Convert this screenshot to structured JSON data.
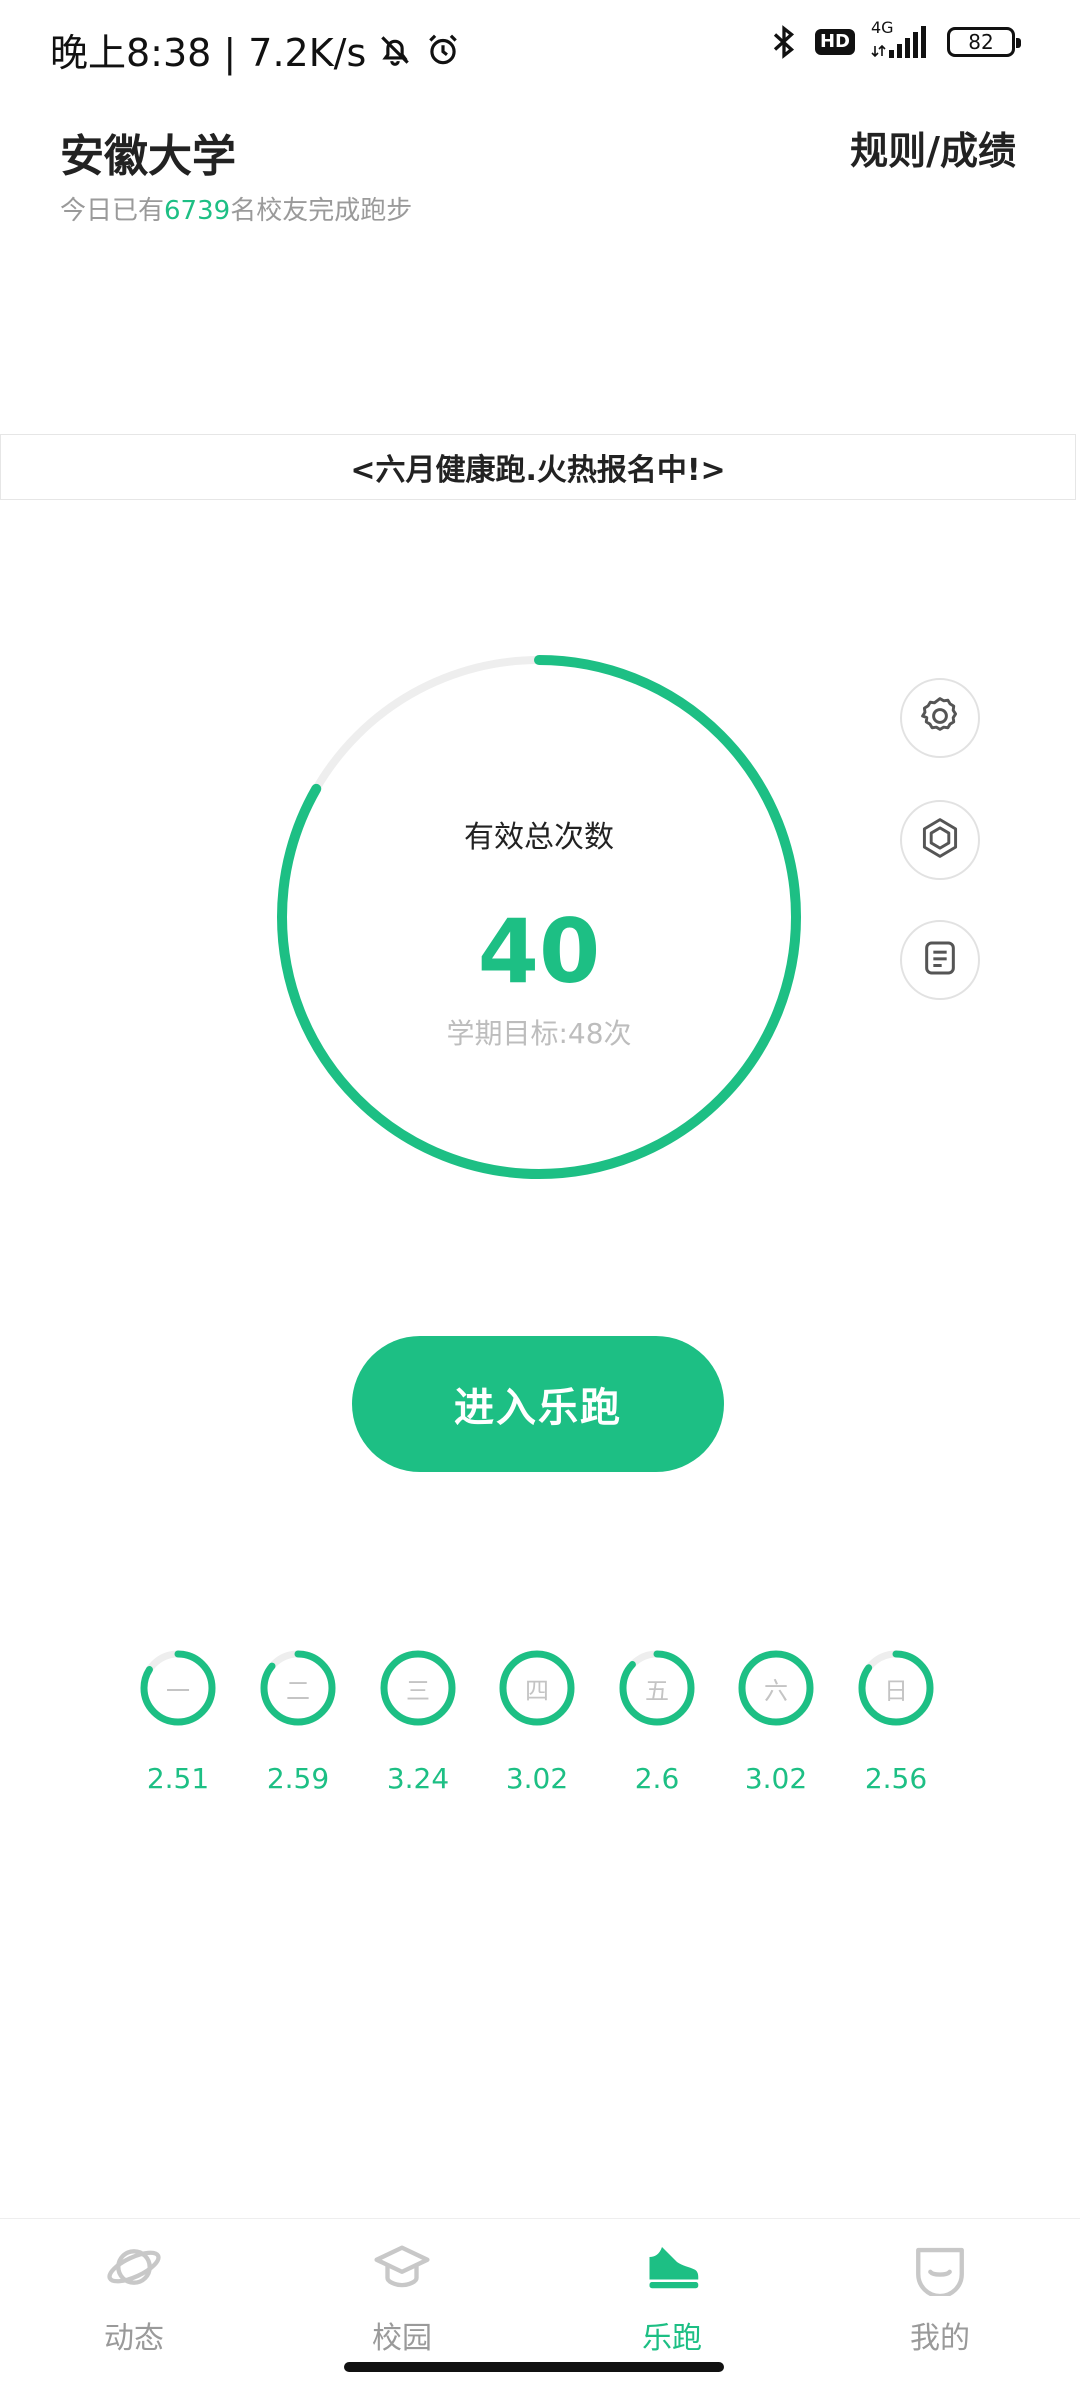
{
  "status_bar": {
    "time_speed": "晚上8:38 | 7.2K/s",
    "hd": "HD",
    "network": "4G",
    "battery": "82"
  },
  "header": {
    "school": "安徽大学",
    "rules_link": "规则/成绩",
    "finished_prefix": "今日已有",
    "finished_count": "6739",
    "finished_suffix": "名校友完成跑步"
  },
  "banner": "<六月健康跑.火热报名中!>",
  "progress": {
    "label": "有效总次数",
    "count": "40",
    "goal_text": "学期目标:48次",
    "fraction": 0.833,
    "accent": "#1dbf84",
    "track": "#eeeeee"
  },
  "side_buttons": [
    {
      "name": "settings",
      "icon": "gear-icon"
    },
    {
      "name": "medal",
      "icon": "hexagon-badge-icon"
    },
    {
      "name": "records",
      "icon": "document-icon"
    }
  ],
  "enter_button": "进入乐跑",
  "week": [
    {
      "day": "一",
      "km": "2.51",
      "fraction": 0.84
    },
    {
      "day": "二",
      "km": "2.59",
      "fraction": 0.86
    },
    {
      "day": "三",
      "km": "3.24",
      "fraction": 1.0
    },
    {
      "day": "四",
      "km": "3.02",
      "fraction": 1.0
    },
    {
      "day": "五",
      "km": "2.6",
      "fraction": 0.87
    },
    {
      "day": "六",
      "km": "3.02",
      "fraction": 1.0
    },
    {
      "day": "日",
      "km": "2.56",
      "fraction": 0.85
    }
  ],
  "nav": [
    {
      "label": "动态",
      "icon": "planet-icon",
      "active": false
    },
    {
      "label": "校园",
      "icon": "graduation-cap-icon",
      "active": false
    },
    {
      "label": "乐跑",
      "icon": "sneaker-icon",
      "active": true
    },
    {
      "label": "我的",
      "icon": "smile-face-icon",
      "active": false
    }
  ]
}
